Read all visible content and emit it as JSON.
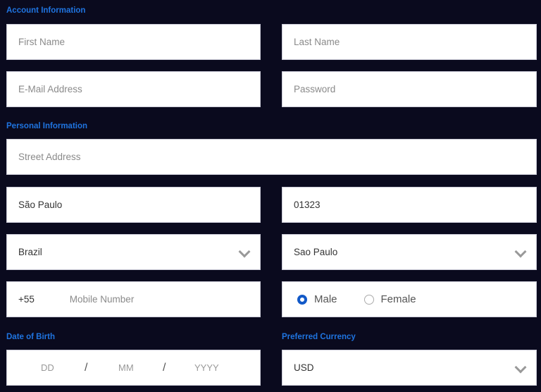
{
  "colors": {
    "background": "#0a0a1e",
    "section_label": "#1f74e0",
    "radio_selected": "#1259c8"
  },
  "account": {
    "title": "Account Information",
    "first_name": {
      "placeholder": "First Name",
      "value": ""
    },
    "last_name": {
      "placeholder": "Last Name",
      "value": ""
    },
    "email": {
      "placeholder": "E-Mail Address",
      "value": ""
    },
    "password": {
      "placeholder": "Password",
      "value": ""
    }
  },
  "personal": {
    "title": "Personal Information",
    "street": {
      "placeholder": "Street Address",
      "value": ""
    },
    "city": {
      "value": "São Paulo"
    },
    "zip": {
      "value": "01323"
    },
    "country": {
      "selected": "Brazil",
      "icon": "chevron-down-icon"
    },
    "state": {
      "selected": "Sao Paulo",
      "icon": "chevron-down-icon"
    },
    "phone_code": "+55",
    "mobile": {
      "placeholder": "Mobile Number",
      "value": ""
    },
    "gender": {
      "options": [
        "Male",
        "Female"
      ],
      "selected": "Male"
    }
  },
  "dob": {
    "title": "Date of Birth",
    "day": "DD",
    "month": "MM",
    "year": "YYYY",
    "separator": "/"
  },
  "currency": {
    "title": "Preferred Currency",
    "selected": "USD",
    "icon": "chevron-down-icon"
  }
}
